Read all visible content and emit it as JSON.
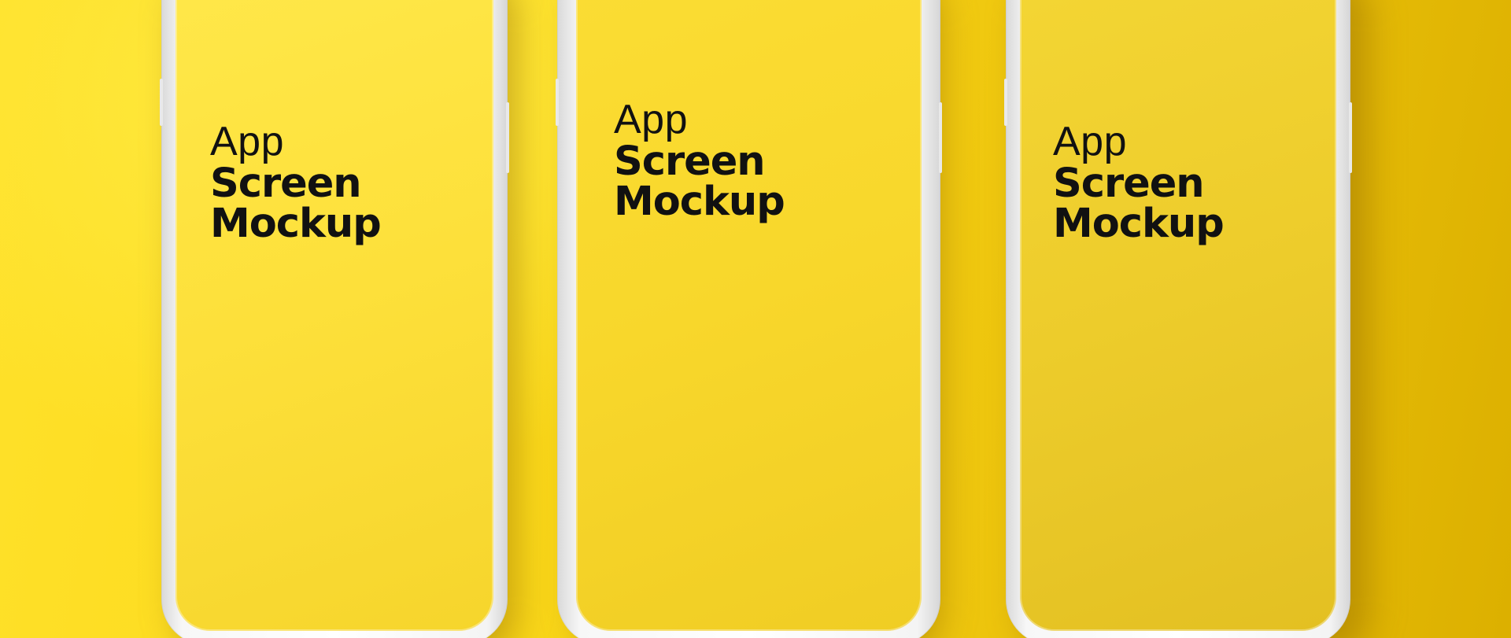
{
  "colors": {
    "background": "#f6d21e",
    "phone_frame": "#ffffff",
    "text": "#111111"
  },
  "phones": [
    {
      "screen_color": "#fde23d",
      "lines": {
        "line1": "App",
        "line2": "Screen",
        "line3": "Mockup"
      }
    },
    {
      "screen_color": "#f9d92e",
      "lines": {
        "line1": "App",
        "line2": "Screen",
        "line3": "Mockup"
      }
    },
    {
      "screen_color": "#ecc92a",
      "lines": {
        "line1": "App",
        "line2": "Screen",
        "line3": "Mockup"
      }
    }
  ]
}
